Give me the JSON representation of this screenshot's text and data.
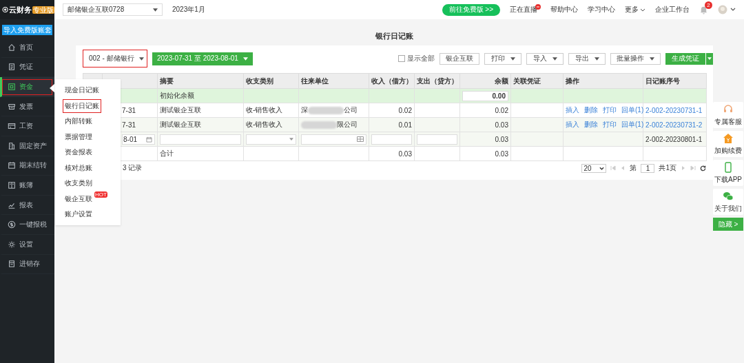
{
  "sidebar": {
    "logo": "云财务",
    "edition": "专业版",
    "import_button": "导入免费版账套",
    "items": [
      {
        "label": "首页",
        "selected": false
      },
      {
        "label": "凭证",
        "selected": false
      },
      {
        "label": "资金",
        "selected": true
      },
      {
        "label": "发票",
        "selected": false
      },
      {
        "label": "工资",
        "selected": false
      },
      {
        "label": "固定资产",
        "selected": false
      },
      {
        "label": "期末结转",
        "selected": false
      },
      {
        "label": "账簿",
        "selected": false
      },
      {
        "label": "报表",
        "selected": false
      },
      {
        "label": "一键报税",
        "selected": false
      },
      {
        "label": "设置",
        "selected": false
      },
      {
        "label": "进销存",
        "selected": false
      }
    ]
  },
  "submenu": {
    "items": [
      {
        "label": "现金日记账",
        "selected": false
      },
      {
        "label": "银行日记账",
        "selected": true
      },
      {
        "label": "内部转账",
        "selected": false
      },
      {
        "label": "票据管理",
        "selected": false
      },
      {
        "label": "资金报表",
        "selected": false
      },
      {
        "label": "核对总账",
        "selected": false
      },
      {
        "label": "收支类别",
        "selected": false
      },
      {
        "label": "银企互联",
        "selected": false,
        "badge": "HOT"
      },
      {
        "label": "账户设置",
        "selected": false
      }
    ]
  },
  "topbar": {
    "company": "邮储银企互联0728",
    "period": "2023年1月",
    "upgrade_button": "前往免费版 >>",
    "links": [
      {
        "label": "正在直播",
        "kind": "live"
      },
      {
        "label": "帮助中心",
        "kind": "plain"
      },
      {
        "label": "学习中心",
        "kind": "plain"
      },
      {
        "label": "更多",
        "kind": "dropdown"
      },
      {
        "label": "企业工作台",
        "kind": "plain"
      }
    ],
    "notifications": "2"
  },
  "page": {
    "title": "银行日记账",
    "account": "002 - 邮储银行",
    "date_range": "2023-07-31 至 2023-08-01",
    "show_all": {
      "label": "显示全部",
      "checked": false
    },
    "buttons": [
      {
        "label": "银企互联",
        "kind": "plain"
      },
      {
        "label": "打印",
        "kind": "dropdown"
      },
      {
        "label": "导入",
        "kind": "dropdown"
      },
      {
        "label": "导出",
        "kind": "dropdown"
      },
      {
        "label": "批量操作",
        "kind": "dropdown"
      },
      {
        "label": "生成凭证",
        "kind": "primary"
      }
    ]
  },
  "table": {
    "columns": [
      "摘要",
      "收支类别",
      "往来单位",
      "收入（借方）",
      "支出（贷方）",
      "余额",
      "关联凭证",
      "操作",
      "日记账序号"
    ],
    "rows": [
      {
        "kind": "opening",
        "summary": "初始化余额",
        "balance": "0.00"
      },
      {
        "kind": "entry",
        "date": "7-31",
        "summary": "测试银企互联",
        "category": "收-销售收入",
        "partner_start": "深",
        "partner_end": "公司",
        "income": "0.02",
        "balance": "0.02",
        "actions": [
          "插入",
          "删除",
          "打印",
          "回单(1)"
        ],
        "serial": "2-002-20230731-1"
      },
      {
        "kind": "entry",
        "date": "7-31",
        "summary": "测试银企互联",
        "category": "收-销售收入",
        "partner_end": "限公司",
        "income": "0.01",
        "balance": "0.03",
        "actions": [
          "插入",
          "删除",
          "打印",
          "回单(1)"
        ],
        "serial": "2-002-20230731-2"
      },
      {
        "kind": "edit",
        "date": "8-01",
        "balance": "0.03",
        "serial": "2-002-20230801-1"
      },
      {
        "kind": "total",
        "summary": "合计",
        "income": "0.03",
        "balance": "0.03"
      }
    ],
    "count": "3 记录"
  },
  "pagination": {
    "page_size": "20",
    "page_label": "第",
    "page": "1",
    "total_pages": "共1页"
  },
  "side_tools": {
    "items": [
      "专属客服",
      "加购续费",
      "下载APP",
      "关于我们"
    ],
    "hide_button": "隐藏 >"
  }
}
